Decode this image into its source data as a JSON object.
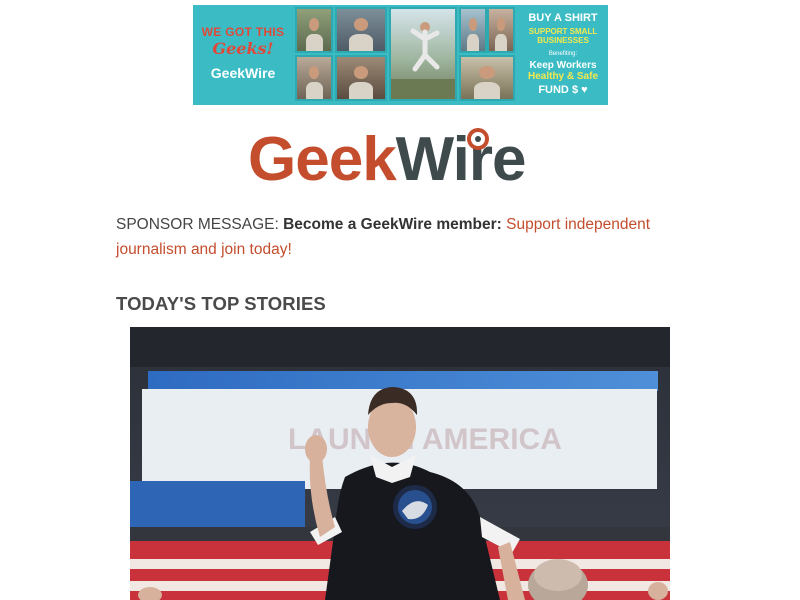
{
  "banner": {
    "headline_line1": "WE GOT THIS",
    "headline_line2": "Geeks!",
    "brand": "GeekWire",
    "cta": "BUY A SHIRT",
    "cta_sub_line1": "SUPPORT SMALL",
    "cta_sub_line2": "BUSINESSES",
    "benefiting": "Benefiting:",
    "fund_line1": "Keep Workers",
    "fund_line2": "Healthy & Safe",
    "fund_line3": "FUND",
    "fund_symbols": "$",
    "colors": {
      "background": "#3bbcc4",
      "accent_red": "#e0493a",
      "accent_yellow": "#f2e94e"
    }
  },
  "logo": {
    "part1": "Geek",
    "part2": "Wire",
    "colors": {
      "geek": "#c44d2e",
      "wire": "#3e4a4c"
    }
  },
  "sponsor": {
    "lead": "SPONSOR MESSAGE:",
    "bold": "Become a GeekWire member:",
    "link": "Support independent journalism and join today!"
  },
  "section": {
    "heading": "TODAY'S TOP STORIES"
  },
  "story": {
    "backdrop_text": "LAUNCH AMERICA"
  }
}
